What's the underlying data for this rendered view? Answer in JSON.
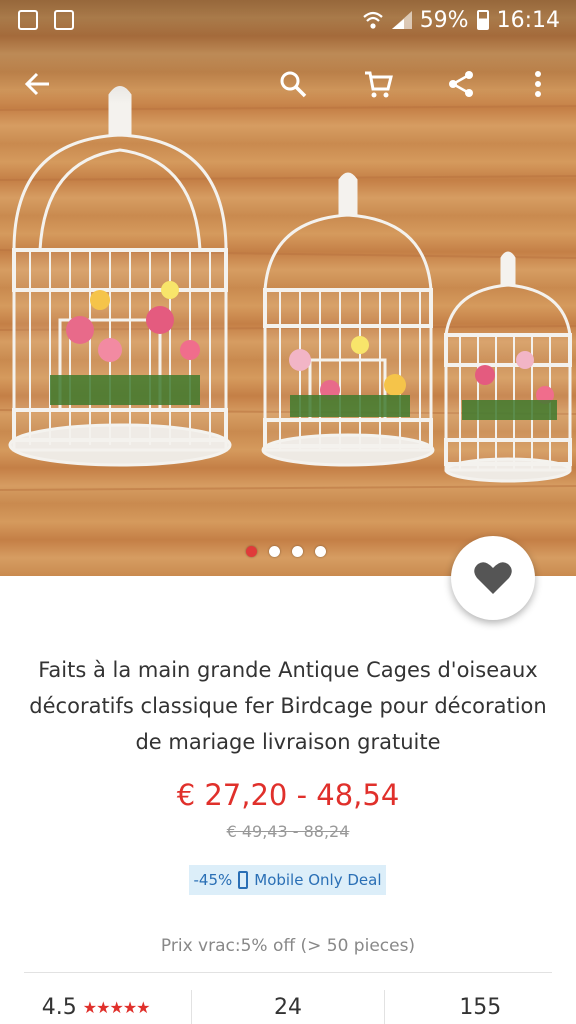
{
  "status_bar": {
    "battery": "59%",
    "time": "16:14"
  },
  "toolbar": {
    "back_icon": "arrow-left-icon",
    "search_icon": "search-icon",
    "cart_icon": "cart-icon",
    "share_icon": "share-icon",
    "more_icon": "more-vert-icon"
  },
  "gallery": {
    "image_count": 4,
    "active_index": 0
  },
  "product": {
    "title": "Faits à la main grande Antique Cages d'oiseaux décoratifs classique fer Birdcage pour décoration de mariage livraison gratuite",
    "price": "€ 27,20 - 48,54",
    "old_price": "€ 49,43 - 88,24",
    "deal_discount": "-45%",
    "deal_label": "Mobile Only Deal",
    "bulk_price": "Prix vrac:5% off (> 50 pieces)"
  },
  "stats": {
    "rating": "4.5",
    "rating_stars": "★★★★★",
    "reviews": "24",
    "orders": "155"
  },
  "colors": {
    "accent": "#e0302b",
    "deal_bg": "#dceef9",
    "deal_text": "#2a6fb5"
  }
}
